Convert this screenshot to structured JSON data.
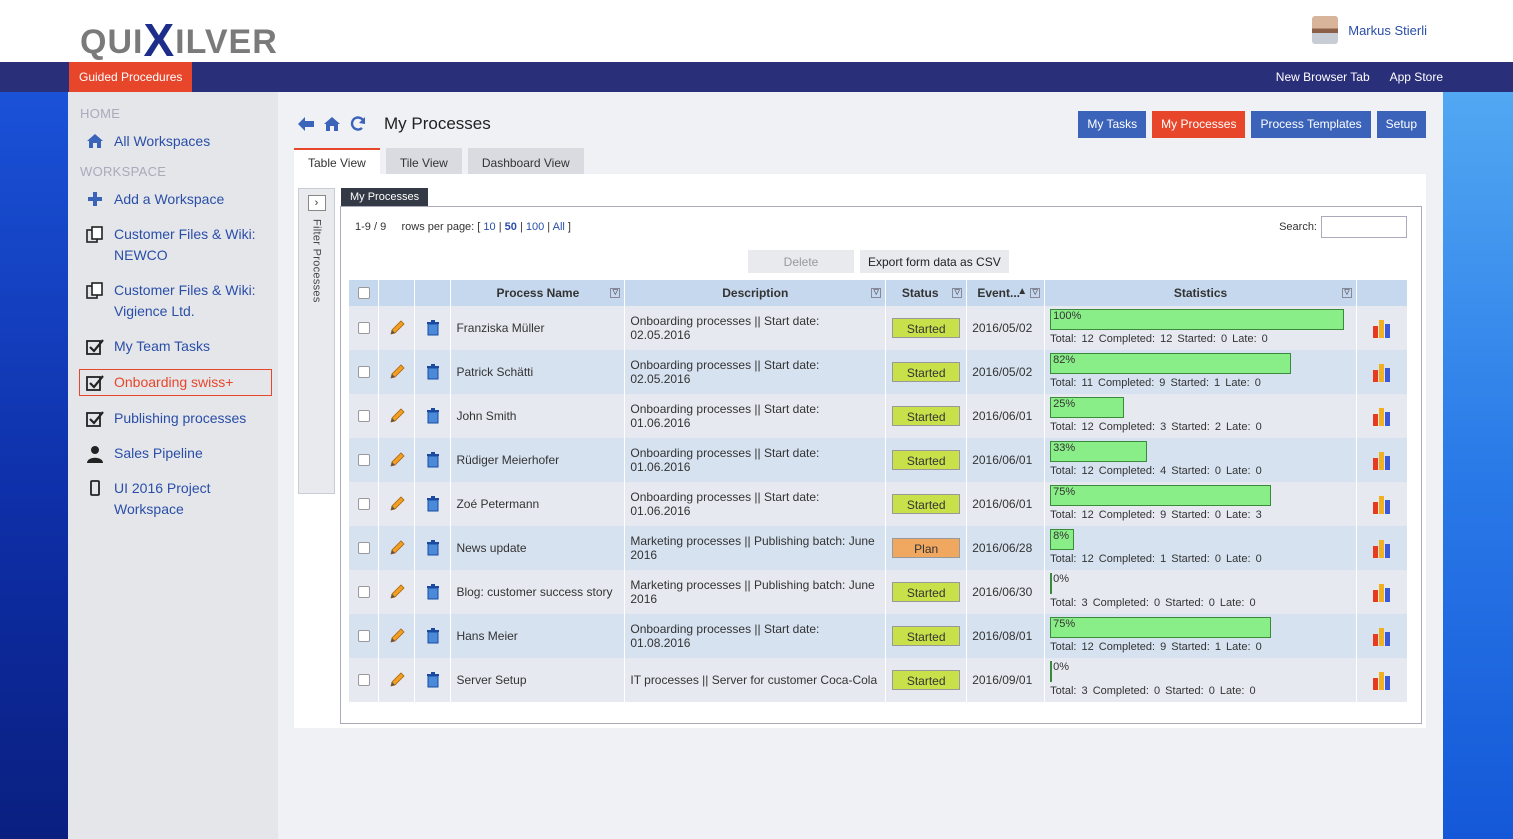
{
  "header": {
    "logo_text": "QUIXILVER",
    "user_name": "Markus Stierli"
  },
  "navbar": {
    "active": "Guided Procedures",
    "right_links": [
      "New Browser Tab",
      "App Store"
    ]
  },
  "sidebar": {
    "home_heading": "HOME",
    "workspace_heading": "WORKSPACE",
    "home_items": [
      {
        "label": "All Workspaces",
        "icon": "home-icon"
      }
    ],
    "workspace_items": [
      {
        "label": "Add a Workspace",
        "icon": "plus-icon"
      },
      {
        "label": "Customer Files & Wiki: NEWCO",
        "icon": "copy-icon"
      },
      {
        "label": "Customer Files & Wiki: Vigience Ltd.",
        "icon": "copy-icon"
      },
      {
        "label": "My Team Tasks",
        "icon": "checkbox-icon"
      },
      {
        "label": "Onboarding swiss+",
        "icon": "checkbox-icon",
        "active": true
      },
      {
        "label": "Publishing processes",
        "icon": "checkbox-icon"
      },
      {
        "label": "Sales Pipeline",
        "icon": "person-icon"
      },
      {
        "label": "UI 2016 Project Workspace",
        "icon": "mobile-icon"
      }
    ]
  },
  "page": {
    "title": "My Processes",
    "top_buttons": [
      "My Tasks",
      "My Processes",
      "Process Templates",
      "Setup"
    ],
    "active_top_button": "My Processes",
    "tabs": [
      "Table View",
      "Tile View",
      "Dashboard View"
    ],
    "active_tab": "Table View",
    "filter_label": "Filter Processes",
    "grid_title": "My Processes"
  },
  "grid": {
    "range": "1-9 / 9",
    "rows_per_page_label": "rows per page:",
    "page_size_options": [
      "10",
      "50",
      "100",
      "All"
    ],
    "selected_page_size": "50",
    "search_label": "Search:",
    "search_value": "",
    "delete_label": "Delete",
    "export_label": "Export form data as CSV",
    "columns": [
      "Process Name",
      "Description",
      "Status",
      "Event...",
      "Statistics"
    ],
    "rows": [
      {
        "name": "Franziska Müller",
        "desc": "Onboarding processes || Start date: 02.05.2016",
        "status": "Started",
        "event": "2016/05/02",
        "pct": 100,
        "pct_label": "100%",
        "stats": "Total: 12  Completed: 12  Started: 0  Late: 0"
      },
      {
        "name": "Patrick Schätti",
        "desc": "Onboarding processes || Start date: 02.05.2016",
        "status": "Started",
        "event": "2016/05/02",
        "pct": 82,
        "pct_label": "82%",
        "stats": "Total: 11  Completed: 9  Started: 1  Late: 0"
      },
      {
        "name": "John Smith",
        "desc": "Onboarding processes || Start date: 01.06.2016",
        "status": "Started",
        "event": "2016/06/01",
        "pct": 25,
        "pct_label": "25%",
        "stats": "Total: 12  Completed: 3  Started: 2  Late: 0"
      },
      {
        "name": "Rüdiger Meierhofer",
        "desc": "Onboarding processes || Start date: 01.06.2016",
        "status": "Started",
        "event": "2016/06/01",
        "pct": 33,
        "pct_label": "33%",
        "stats": "Total: 12  Completed: 4  Started: 0  Late: 0"
      },
      {
        "name": "Zoé Petermann",
        "desc": "Onboarding processes || Start date: 01.06.2016",
        "status": "Started",
        "event": "2016/06/01",
        "pct": 75,
        "pct_label": "75%",
        "stats": "Total: 12  Completed: 9  Started: 0  Late: 3"
      },
      {
        "name": "News update",
        "desc": "Marketing processes || Publishing batch: June 2016",
        "status": "Plan",
        "event": "2016/06/28",
        "pct": 8,
        "pct_label": "8%",
        "stats": "Total: 12  Completed: 1  Started: 0  Late: 0"
      },
      {
        "name": "Blog: customer success story",
        "desc": "Marketing processes || Publishing batch: June 2016",
        "status": "Started",
        "event": "2016/06/30",
        "pct": 0,
        "pct_label": "0%",
        "stats": "Total: 3  Completed: 0  Started: 0  Late: 0"
      },
      {
        "name": "Hans Meier",
        "desc": "Onboarding processes || Start date: 01.08.2016",
        "status": "Started",
        "event": "2016/08/01",
        "pct": 75,
        "pct_label": "75%",
        "stats": "Total: 12  Completed: 9  Started: 1  Late: 0"
      },
      {
        "name": "Server Setup",
        "desc": "IT processes || Server for customer Coca-Cola",
        "status": "Started",
        "event": "2016/09/01",
        "pct": 0,
        "pct_label": "0%",
        "stats": "Total: 3  Completed: 0  Started: 0  Late: 0"
      }
    ]
  },
  "colors": {
    "accent": "#e8462b",
    "navbar": "#2a2f7a",
    "button_blue": "#3b63ba",
    "started": "#c8e04a",
    "plan": "#f0a860",
    "progress": "#8aee88"
  }
}
